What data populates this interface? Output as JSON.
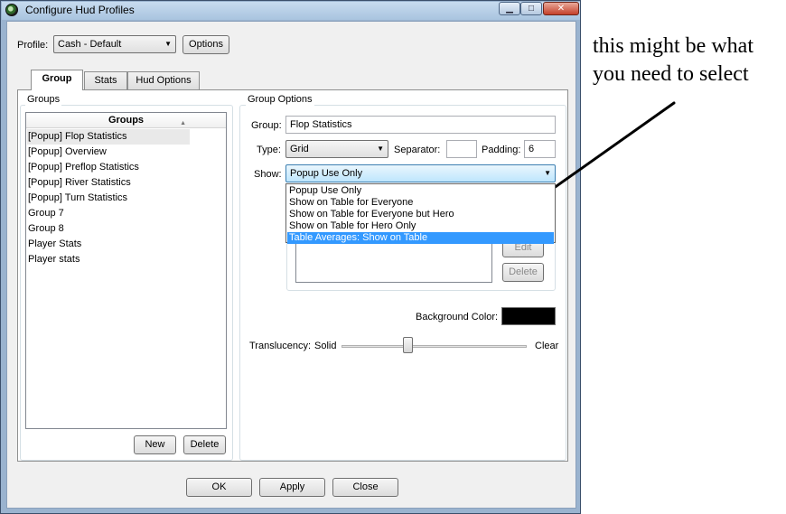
{
  "window": {
    "title": "Configure Hud Profiles",
    "min_glyph": "▁",
    "max_glyph": "□",
    "close_glyph": "✕"
  },
  "profile": {
    "label": "Profile:",
    "value": "Cash - Default",
    "options_button": "Options"
  },
  "tabs": [
    {
      "label": "Group"
    },
    {
      "label": "Stats"
    },
    {
      "label": "Hud Options"
    }
  ],
  "groups": {
    "title": "Groups",
    "column_header": "Groups",
    "items": [
      "[Popup] Flop Statistics",
      "[Popup] Overview",
      "[Popup] Preflop Statistics",
      "[Popup] River Statistics",
      "[Popup] Turn Statistics",
      "Group 7",
      "Group 8",
      "Player Stats",
      "Player stats"
    ],
    "new_button": "New",
    "delete_button": "Delete"
  },
  "group_options": {
    "title": "Group Options",
    "group_label": "Group:",
    "group_value": "Flop Statistics",
    "type_label": "Type:",
    "type_value": "Grid",
    "separator_label": "Separator:",
    "separator_value": "",
    "padding_label": "Padding:",
    "padding_value": "6",
    "show_label": "Show:",
    "show_value": "Popup Use Only",
    "show_options": [
      "Popup Use Only",
      "Show on Table for Everyone",
      "Show on Table for Everyone but Hero",
      "Show on Table for Hero Only",
      "Table Averages: Show on Table"
    ],
    "highlighted_option_index": 4,
    "edit_button": "Edit",
    "delete_button": "Delete",
    "background_label": "Background Color:",
    "background_color": "#000000",
    "translucency_label": "Translucency:",
    "translucency_min": "Solid",
    "translucency_max": "Clear",
    "translucency_value": 0.36
  },
  "footer": {
    "ok": "OK",
    "apply": "Apply",
    "close": "Close"
  },
  "annotation": {
    "line1": "this might be what",
    "line2": "you need to select"
  },
  "colors": {
    "selection": "#3399ff",
    "titlebar": "#b8cfe7",
    "close_button": "#c4402a"
  }
}
